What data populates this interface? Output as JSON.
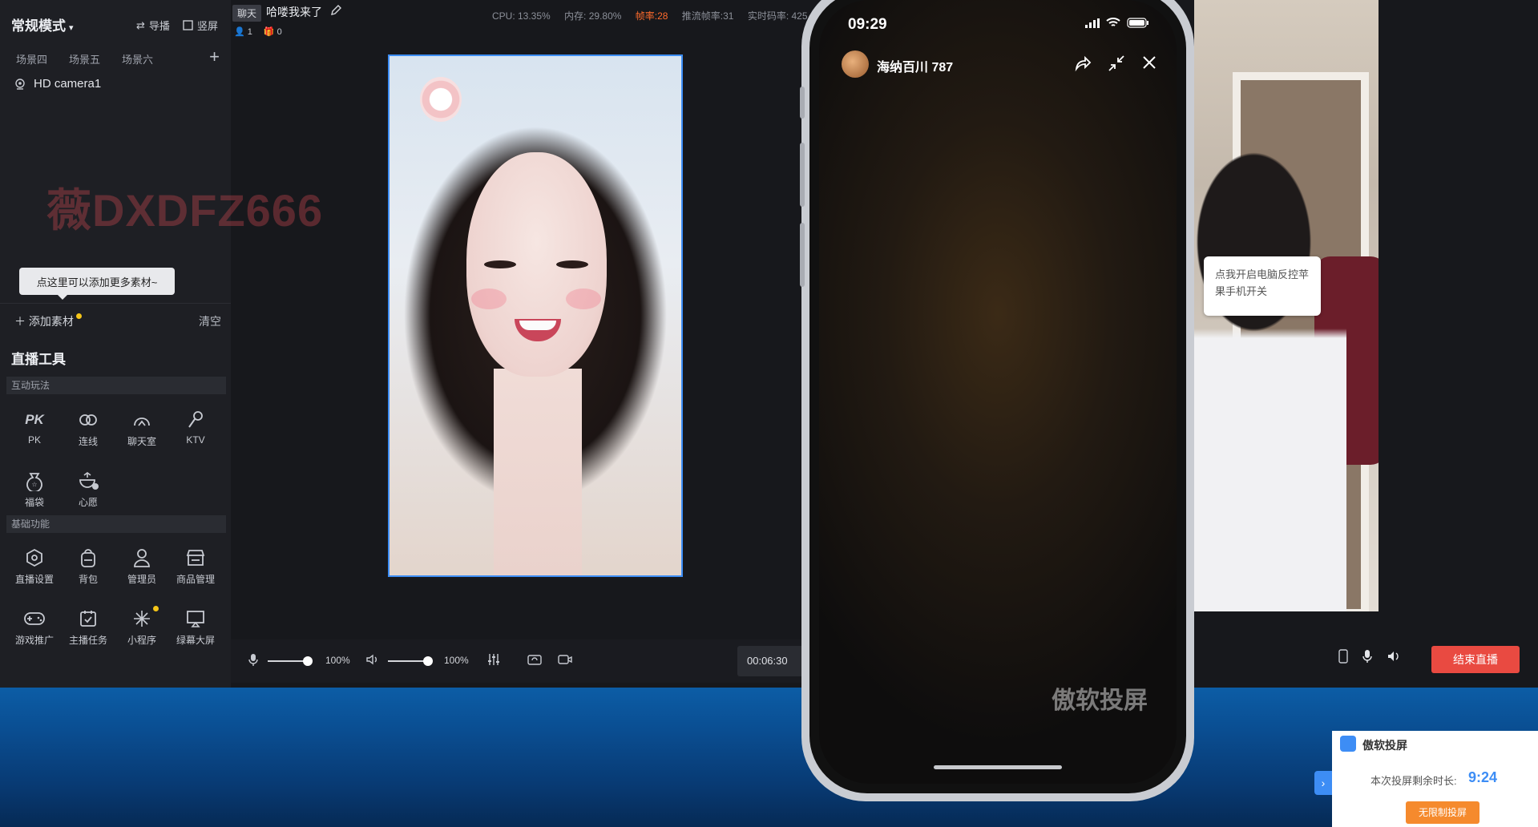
{
  "left_panel": {
    "mode": "常规模式",
    "header_buttons": {
      "import": "导播",
      "split": "竖屏"
    },
    "scene_tabs": [
      "场景四",
      "场景五",
      "场景六"
    ],
    "source": "HD camera1",
    "watermark": "薇DXDFZ666",
    "tooltip": "点这里可以添加更多素材~",
    "add_source": "添加素材",
    "clear": "清空",
    "tools_title": "直播工具",
    "section_interactive": "互动玩法",
    "interactive_tools": [
      "PK",
      "连线",
      "聊天室",
      "KTV",
      "福袋",
      "心愿"
    ],
    "section_basic": "基础功能",
    "basic_tools": [
      "直播设置",
      "背包",
      "管理员",
      "商品管理",
      "游戏推广",
      "主播任务",
      "小程序",
      "绿幕大屏"
    ]
  },
  "topbar": {
    "chat_tag": "聊天",
    "room_title": "哈喽我来了",
    "viewers": "1",
    "gifts": "0",
    "cpu": "CPU: 13.35%",
    "memory": "内存: 29.80%",
    "framerate": "帧率:28",
    "push_framerate": "推流帧率:31",
    "bitrate": "实时码率: 425"
  },
  "controls": {
    "mic_volume": "100%",
    "speaker_volume": "100%",
    "mic_level": 1.0,
    "speaker_level": 1.0,
    "duration": "00:06:30"
  },
  "phone": {
    "time": "09:29",
    "host_name": "海纳百川 787",
    "watermark": "傲软投屏"
  },
  "right_panel": {
    "popup": "点我开启电脑反控苹果手机开关",
    "end_live": "结束直播"
  },
  "notification": {
    "title": "傲软投屏",
    "label": "本次投屏剩余时长:",
    "time": "9:24",
    "button": "无限制投屏"
  },
  "colors": {
    "accent": "#3d8df5",
    "danger": "#e94a41",
    "warning": "#ff6b2c",
    "orange_button": "#f58a2d"
  }
}
